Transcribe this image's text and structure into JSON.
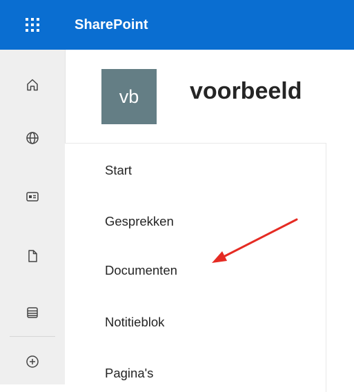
{
  "suitebar": {
    "brand": "SharePoint",
    "waffle_icon": "app-launcher-icon",
    "color": "#0a6ed1"
  },
  "rail": {
    "items": [
      {
        "icon": "home-icon"
      },
      {
        "icon": "globe-icon"
      },
      {
        "icon": "news-icon"
      },
      {
        "icon": "document-icon"
      },
      {
        "icon": "list-icon"
      },
      {
        "icon": "add-circle-icon"
      }
    ]
  },
  "site": {
    "logo_text": "vb",
    "title": "voorbeeld",
    "logo_color": "#647e85"
  },
  "nav": {
    "items": [
      {
        "label": "Start"
      },
      {
        "label": "Gesprekken"
      },
      {
        "label": "Documenten"
      },
      {
        "label": "Notitieblok"
      },
      {
        "label": "Pagina's"
      }
    ]
  },
  "annotation": {
    "arrow_icon": "red-arrow-icon",
    "color": "#e52b23"
  }
}
